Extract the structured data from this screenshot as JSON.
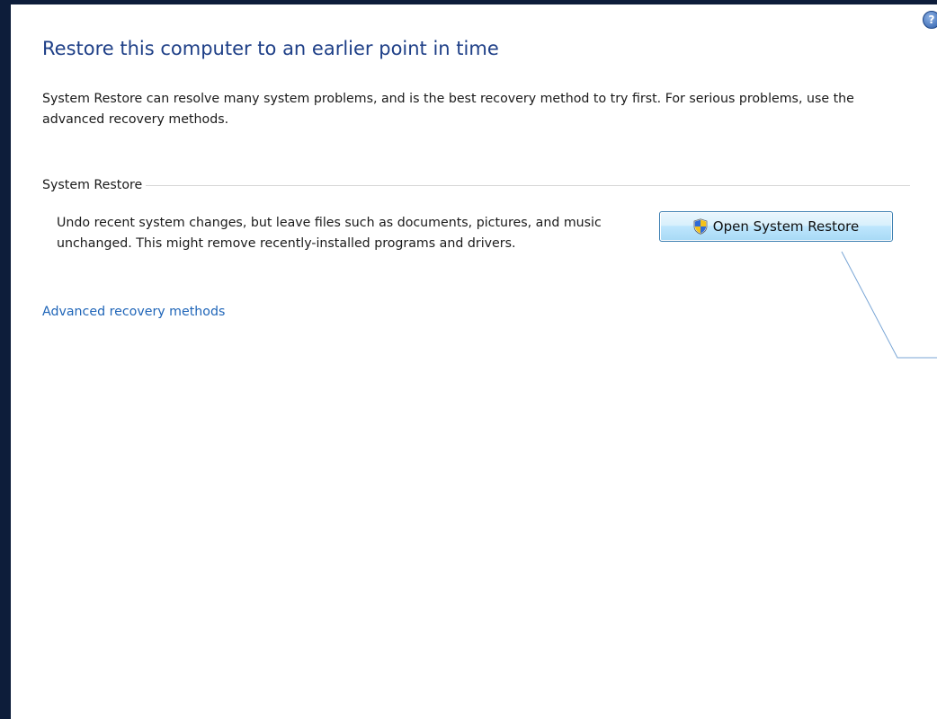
{
  "page": {
    "title": "Restore this computer to an earlier point in time",
    "intro": "System Restore can resolve many system problems, and is the best recovery method to try first. For serious problems, use the advanced recovery methods.",
    "help_icon_glyph": "?"
  },
  "system_restore": {
    "group_label": "System Restore",
    "description": "Undo recent system changes, but leave files such as documents, pictures, and music unchanged. This might remove recently-installed programs and drivers.",
    "button_label": "Open System Restore",
    "button_icon": "uac-shield-icon"
  },
  "advanced": {
    "link_label": "Advanced recovery methods"
  },
  "colors": {
    "title": "#1e3f87",
    "link": "#1f65b8",
    "desktop_background": "#0d1d3a"
  }
}
